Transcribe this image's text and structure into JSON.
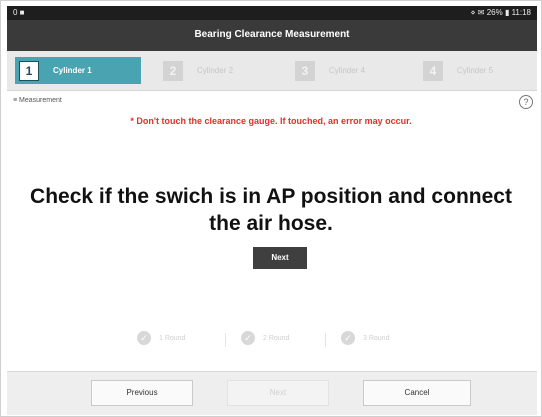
{
  "statusbar": {
    "left": "0 ■",
    "right": "⋄ ✉ 26% ▮ 11:18"
  },
  "window": {
    "title": "Bearing Clearance Measurement"
  },
  "steps": [
    {
      "num": "1",
      "label": "Cylinder 1"
    },
    {
      "num": "2",
      "label": "Cylinder 2"
    },
    {
      "num": "3",
      "label": "Cylinder 4"
    },
    {
      "num": "4",
      "label": "Cylinder 5"
    }
  ],
  "measurement": {
    "label": "≡ Measurement",
    "help_icon": "question-circle-icon",
    "help_glyph": "?"
  },
  "warning": "* Don't touch the clearance gauge. If touched, an error may occur.",
  "instruction": "Check if the swich is in AP position and connect the air hose.",
  "next_inline": "Next",
  "rounds": [
    {
      "label": "1 Round",
      "glyph": "✓"
    },
    {
      "label": "2 Round",
      "glyph": "✓"
    },
    {
      "label": "3 Round",
      "glyph": "✓"
    }
  ],
  "footer": {
    "previous": "Previous",
    "next": "Next",
    "cancel": "Cancel"
  }
}
